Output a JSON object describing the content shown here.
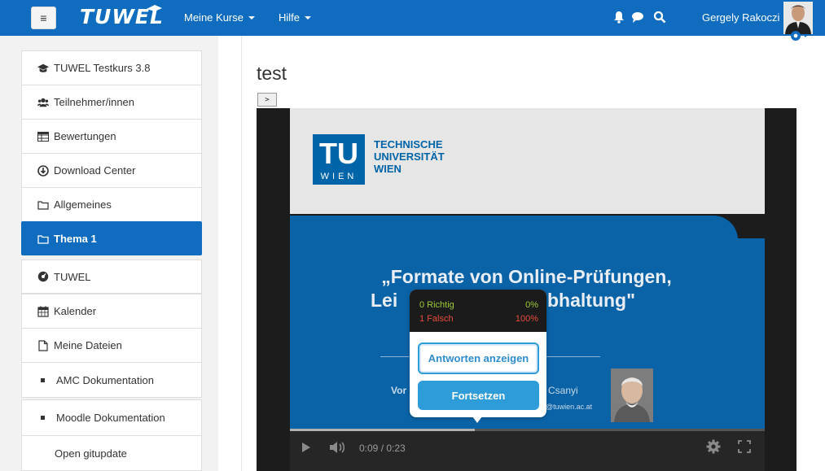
{
  "colors": {
    "navbar": "#0f6cbf",
    "active": "#0f6cbf",
    "quiz_button": "#2e9cd8",
    "correct": "#9ccc35",
    "wrong": "#e74c3c"
  },
  "navbar": {
    "brand": "TUWEL",
    "menu_courses": "Meine Kurse",
    "menu_help": "Hilfe",
    "user_name": "Gergely Rakoczi",
    "icons": [
      "bell-icon",
      "chat-icon",
      "search-icon"
    ]
  },
  "sidebar": {
    "items": [
      {
        "label": "TUWEL Testkurs 3.8",
        "icon": "graduation-cap-icon"
      },
      {
        "label": "Teilnehmer/innen",
        "icon": "users-icon"
      },
      {
        "label": "Bewertungen",
        "icon": "table-icon"
      },
      {
        "label": "Download Center",
        "icon": "download-icon"
      },
      {
        "label": "Allgemeines",
        "icon": "folder-icon"
      },
      {
        "label": "Thema 1",
        "icon": "folder-icon",
        "active": true
      },
      {
        "label": "TUWEL",
        "icon": "dashboard-icon"
      },
      {
        "label": "Kalender",
        "icon": "calendar-icon"
      },
      {
        "label": "Meine Dateien",
        "icon": "file-icon"
      },
      {
        "label": "AMC Dokumentation",
        "icon": "bullet-icon"
      },
      {
        "label": "Moodle Dokumentation",
        "icon": "bullet-icon"
      },
      {
        "label": "Open gitupdate",
        "icon": ""
      }
    ]
  },
  "main": {
    "title": "test",
    "expand_label": ">"
  },
  "video": {
    "slide": {
      "org_line1": "TECHNISCHE",
      "org_line2": "UNIVERSITÄT",
      "org_line3": "WIEN",
      "logo_letters": "TU",
      "logo_sub": "WIEN",
      "title_line1": "„Formate von Online-Prüfungen,",
      "title_line2a": "Lei",
      "title_line2b": "bhaltung\"",
      "presenter_prefix": "Vor",
      "presenter_suffix": "Csanyi",
      "email_fragment": "@tuwien.ac.at"
    },
    "time": "0:09 / 0:23",
    "progress": 0.39
  },
  "quiz": {
    "correct_label": "0 Richtig",
    "correct_pct": "0%",
    "wrong_label": "1 Falsch",
    "wrong_pct": "100%",
    "show_answers": "Antworten anzeigen",
    "continue": "Fortsetzen"
  }
}
